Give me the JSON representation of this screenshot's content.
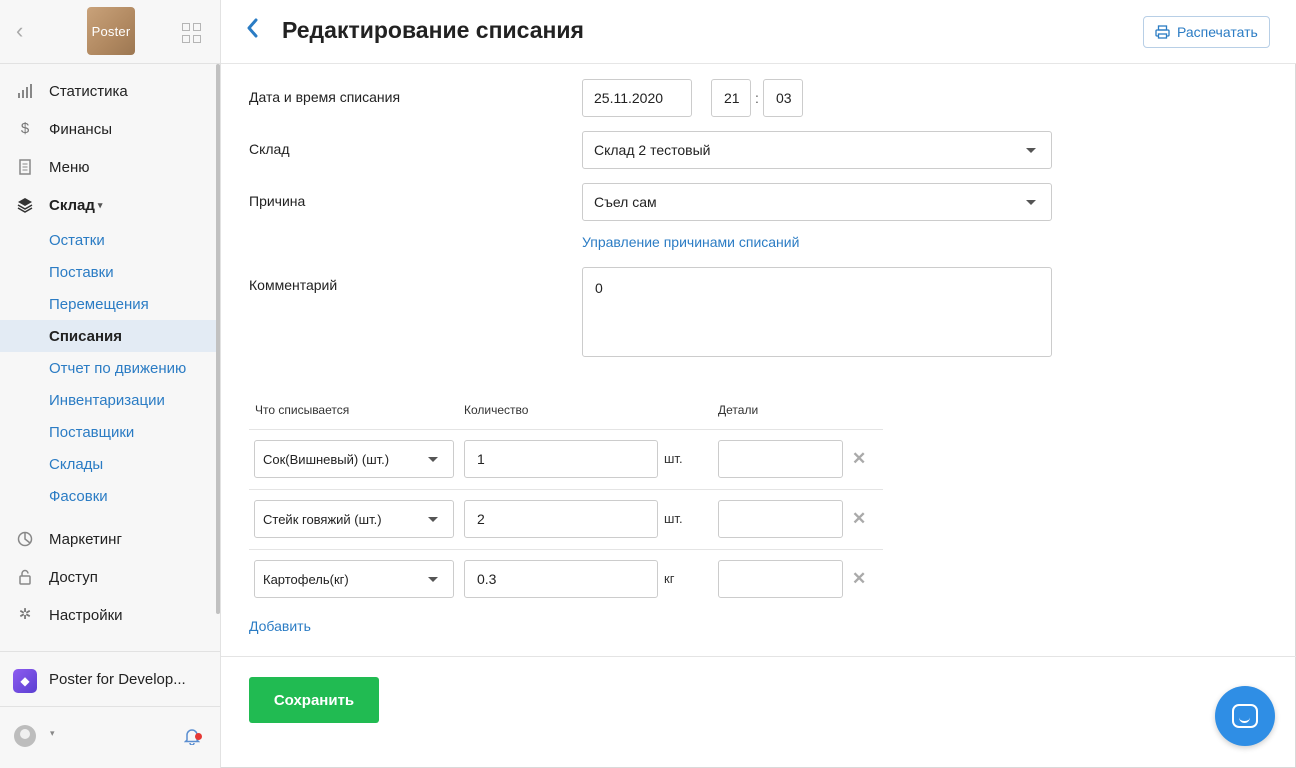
{
  "sidebar": {
    "back_icon": "chevron-left-icon",
    "logo_text": "Poster",
    "apps_icon": "grid-icon",
    "items": [
      {
        "label": "Статистика",
        "icon": "bar-chart-icon"
      },
      {
        "label": "Финансы",
        "icon": "dollar-icon"
      },
      {
        "label": "Меню",
        "icon": "document-icon"
      },
      {
        "label": "Склад",
        "icon": "layers-icon"
      }
    ],
    "warehouse_sub": [
      {
        "label": "Остатки"
      },
      {
        "label": "Поставки"
      },
      {
        "label": "Перемещения"
      },
      {
        "label": "Списания",
        "active": true
      },
      {
        "label": "Отчет по движению"
      },
      {
        "label": "Инвентаризации"
      },
      {
        "label": "Поставщики"
      },
      {
        "label": "Склады"
      },
      {
        "label": "Фасовки"
      }
    ],
    "items_bottom": [
      {
        "label": "Маркетинг",
        "icon": "pie-icon"
      },
      {
        "label": "Доступ",
        "icon": "lock-icon"
      },
      {
        "label": "Настройки",
        "icon": "gear-icon"
      }
    ],
    "dev_label": "Poster for Develop...",
    "accent_color": "#2b7cc4"
  },
  "header": {
    "title": "Редактирование списания",
    "print_label": "Распечатать"
  },
  "form": {
    "datetime_label": "Дата и время списания",
    "date_value": "25.11.2020",
    "hour_value": "21",
    "minute_value": "03",
    "time_separator": ":",
    "warehouse_label": "Склад",
    "warehouse_value": "Склад 2 тестовый",
    "reason_label": "Причина",
    "reason_value": "Съел сам",
    "reasons_link": "Управление причинами списаний",
    "comment_label": "Комментарий",
    "comment_value": "0"
  },
  "table": {
    "col_item": "Что списывается",
    "col_qty": "Количество",
    "col_details": "Детали",
    "rows": [
      {
        "item": "Сок(Вишневый) (шт.)",
        "qty": "1",
        "unit": "шт."
      },
      {
        "item": "Стейк говяжий (шт.)",
        "qty": "2",
        "unit": "шт."
      },
      {
        "item": "Картофель(кг)",
        "qty": "0.3",
        "unit": "кг"
      }
    ],
    "add_label": "Добавить"
  },
  "footer": {
    "save_label": "Сохранить",
    "save_color": "#21bb52"
  }
}
